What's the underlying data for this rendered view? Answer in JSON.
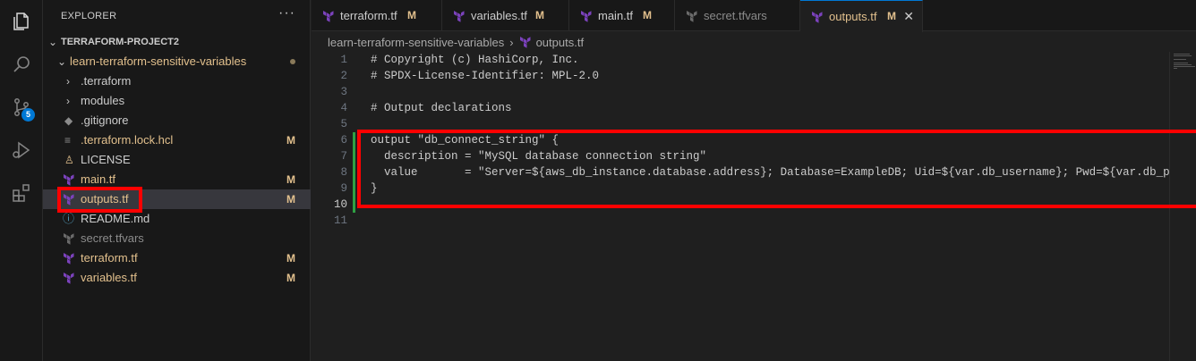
{
  "sidebar": {
    "header": "EXPLORER",
    "more": "···",
    "project": "TERRAFORM-PROJECT2",
    "folder": "learn-terraform-sensitive-variables",
    "items": [
      {
        "label": ".terraform",
        "status": "",
        "type": "folder"
      },
      {
        "label": "modules",
        "status": "",
        "type": "folder"
      },
      {
        "label": ".gitignore",
        "status": "",
        "type": "git"
      },
      {
        "label": ".terraform.lock.hcl",
        "status": "M",
        "type": "lock"
      },
      {
        "label": "LICENSE",
        "status": "",
        "type": "license"
      },
      {
        "label": "main.tf",
        "status": "M",
        "type": "tf"
      },
      {
        "label": "outputs.tf",
        "status": "M",
        "type": "tf"
      },
      {
        "label": "README.md",
        "status": "",
        "type": "info"
      },
      {
        "label": "secret.tfvars",
        "status": "",
        "type": "tf"
      },
      {
        "label": "terraform.tf",
        "status": "M",
        "type": "tf"
      },
      {
        "label": "variables.tf",
        "status": "M",
        "type": "tf"
      }
    ],
    "scm_badge": "5"
  },
  "tabs": [
    {
      "label": "terraform.tf",
      "status": "M"
    },
    {
      "label": "variables.tf",
      "status": "M"
    },
    {
      "label": "main.tf",
      "status": "M"
    },
    {
      "label": "secret.tfvars",
      "status": ""
    },
    {
      "label": "outputs.tf",
      "status": "M",
      "close": "✕"
    }
  ],
  "breadcrumb": {
    "folder": "learn-terraform-sensitive-variables",
    "separator": "›",
    "file": "outputs.tf"
  },
  "editor": {
    "lines": [
      {
        "n": "1",
        "text": "# Copyright (c) HashiCorp, Inc."
      },
      {
        "n": "2",
        "text": "# SPDX-License-Identifier: MPL-2.0"
      },
      {
        "n": "3",
        "text": ""
      },
      {
        "n": "4",
        "text": "# Output declarations"
      },
      {
        "n": "5",
        "text": ""
      },
      {
        "n": "6",
        "text": "output \"db_connect_string\" {"
      },
      {
        "n": "7",
        "text": "  description = \"MySQL database connection string\""
      },
      {
        "n": "8",
        "text": "  value       = \"Server=${aws_db_instance.database.address}; Database=ExampleDB; Uid=${var.db_username}; Pwd=${var.db_passwo"
      },
      {
        "n": "9",
        "text": "}"
      },
      {
        "n": "10",
        "text": ""
      },
      {
        "n": "11",
        "text": ""
      }
    ]
  },
  "colors": {
    "accent": "#0078d4",
    "modified": "#e2c08d",
    "highlight": "#ff0000",
    "terraform_icon": "#7b42bc"
  }
}
